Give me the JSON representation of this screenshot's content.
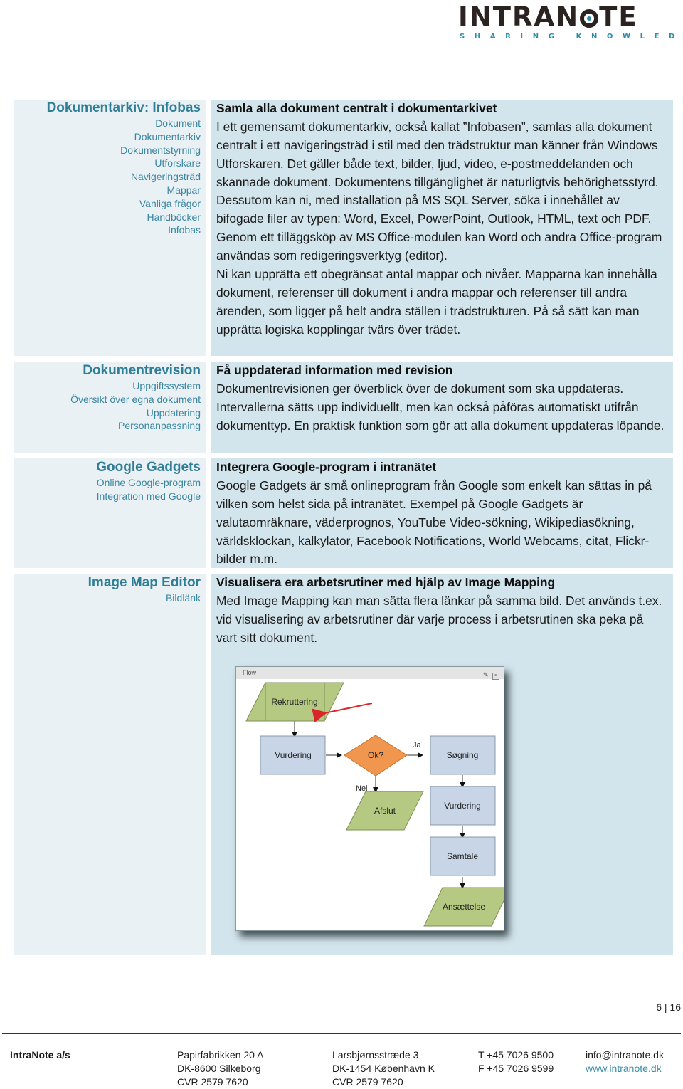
{
  "header": {
    "logo_word_left": "INTRAN",
    "logo_word_right": "TE",
    "logo_tagline": "SHARING KNOWLEDGE",
    "brand_colors": {
      "dark": "#2a2320",
      "accent": "#2f8da8"
    }
  },
  "sections": [
    {
      "sidebar": {
        "title": "Dokumentarkiv: Infobas",
        "items": [
          "Dokument",
          "Dokumentarkiv",
          "Dokumentstyrning",
          "Utforskare",
          "Navigeringsträd",
          "Mappar",
          "Vanliga frågor",
          "Handböcker",
          "Infobas"
        ]
      },
      "content": {
        "heading": "Samla alla dokument centralt i dokumentarkivet",
        "paragraphs": [
          "I ett gemensamt dokumentarkiv, också kallat ”Infobasen”, samlas alla dokument centralt i ett navigeringsträd i stil med den trädstruktur man känner från Windows Utforskaren. Det gäller både text, bilder, ljud, video, e-postmeddelanden och skannade dokument. Dokumentens tillgänglighet är naturligtvis behörighetsstyrd.",
          "Dessutom kan ni, med installation på MS SQL Server, söka i innehållet av bifogade filer av typen: Word, Excel, PowerPoint, Outlook, HTML, text och PDF. Genom ett tilläggsköp av MS Office-modulen kan Word och andra Office-program användas som redigeringsverktyg (editor).",
          "Ni kan upprätta ett obegränsat antal mappar och nivåer. Mapparna kan innehålla dokument, referenser till dokument i andra mappar och referenser till andra ärenden, som ligger på helt andra ställen i trädstrukturen. På så sätt kan man upprätta logiska kopplingar tvärs över trädet."
        ]
      }
    },
    {
      "sidebar": {
        "title": "Dokumentrevision",
        "items": [
          "Uppgiftssystem",
          "Översikt över egna dokument",
          "Uppdatering",
          "Personanpassning"
        ]
      },
      "content": {
        "heading": "Få uppdaterad information med revision",
        "paragraphs": [
          "Dokumentrevisionen ger överblick över de dokument som ska uppdateras. Intervallerna sätts upp individuellt, men kan också påföras automatiskt utifrån dokumenttyp. En praktisk funktion som gör att alla dokument uppdateras löpande."
        ]
      }
    },
    {
      "sidebar": {
        "title": "Google Gadgets",
        "items": [
          "Online Google-program",
          "Integration med Google"
        ]
      },
      "content": {
        "heading": "Integrera Google-program i intranätet",
        "paragraphs": [
          "Google Gadgets är små onlineprogram från Google som enkelt kan sättas in på vilken som helst sida på intranätet. Exempel på Google Gadgets är valutaomräknare, väderprognos, YouTube Video-sökning, Wikipediasökning, världsklockan, kalkylator, Facebook Notifications, World Webcams, citat, Flickr-bilder m.m."
        ]
      }
    },
    {
      "sidebar": {
        "title": "Image Map Editor",
        "items": [
          "Bildlänk"
        ]
      },
      "content": {
        "heading": "Visualisera era arbetsrutiner med hjälp av Image Mapping",
        "paragraphs": [
          "Med Image Mapping kan man sätta flera länkar på samma bild. Det används t.ex. vid visualisering av arbetsrutiner där varje process i arbetsrutinen ska peka på vart sitt dokument."
        ]
      }
    }
  ],
  "flow_window": {
    "title": "Flow",
    "nodes": {
      "rekruttering": "Rekruttering",
      "vurdering1": "Vurdering",
      "ok": "Ok?",
      "sogning": "Søgning",
      "afslut": "Afslut",
      "vurdering2": "Vurdering",
      "samtale": "Samtale",
      "ansaettelse": "Ansættelse"
    },
    "edge_labels": {
      "yes": "Ja",
      "no": "Nej"
    },
    "colors": {
      "process": "#c7d5e6",
      "io": "#b5c982",
      "decision": "#f0964e",
      "pointer": "#d9262b"
    }
  },
  "page": {
    "current": "6",
    "separator": "|",
    "total": "16"
  },
  "footer": {
    "company": "IntraNote a/s",
    "address1": [
      "Papirfabrikken 20 A",
      "DK-8600 Silkeborg",
      "CVR 2579 7620"
    ],
    "address2": [
      "Larsbjørnsstræde 3",
      "DK-1454 København K",
      "CVR 2579 7620"
    ],
    "phone": "T +45 7026 9500",
    "fax": "F +45 7026 9599",
    "email": "info@intranote.dk",
    "web": "www.intranote.dk"
  }
}
